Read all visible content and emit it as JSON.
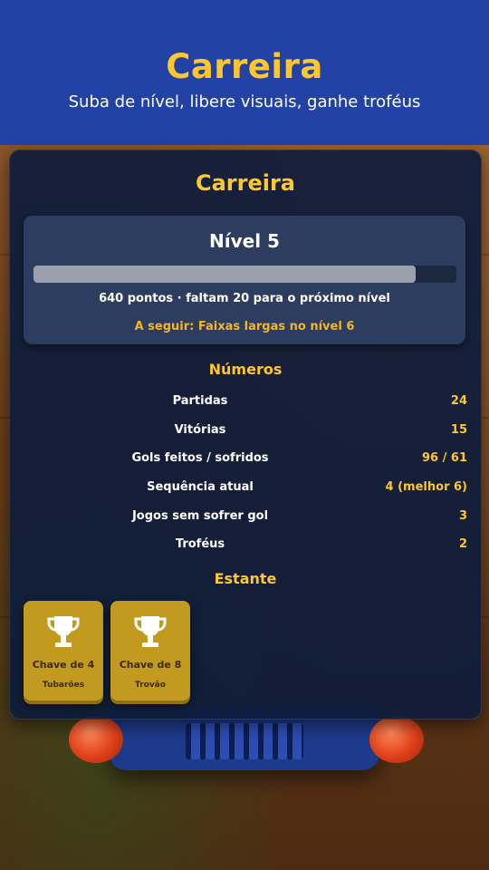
{
  "header": {
    "title": "Carreira",
    "subtitle": "Suba de nível, libere visuais, ganhe troféus"
  },
  "panel": {
    "title": "Carreira",
    "level": {
      "title": "Nível 5",
      "progress_fraction": 0.904,
      "points_text": "640 pontos · faltam 20 para o próximo nível",
      "next_unlock": "A seguir: Faixas largas no nível 6"
    },
    "stats": {
      "title": "Números",
      "rows": [
        {
          "label": "Partidas",
          "value": "24"
        },
        {
          "label": "Vitórias",
          "value": "15"
        },
        {
          "label": "Gols feitos / sofridos",
          "value": "96 / 61"
        },
        {
          "label": "Sequência atual",
          "value": "4 (melhor 6)"
        },
        {
          "label": "Jogos sem sofrer gol",
          "value": "3"
        },
        {
          "label": "Troféus",
          "value": "2"
        }
      ]
    },
    "shelf": {
      "title": "Estante",
      "trophies": [
        {
          "name": "Chave de 4",
          "subtitle": "Tubarões",
          "icon": "trophy-icon"
        },
        {
          "name": "Chave de 8",
          "subtitle": "Trovão",
          "icon": "trophy-icon"
        }
      ]
    }
  },
  "colors": {
    "header_bg": "#2342a6",
    "accent": "#ffc62e",
    "panel_bg": "#0e1c3a",
    "trophy_card": "#c29a20"
  }
}
